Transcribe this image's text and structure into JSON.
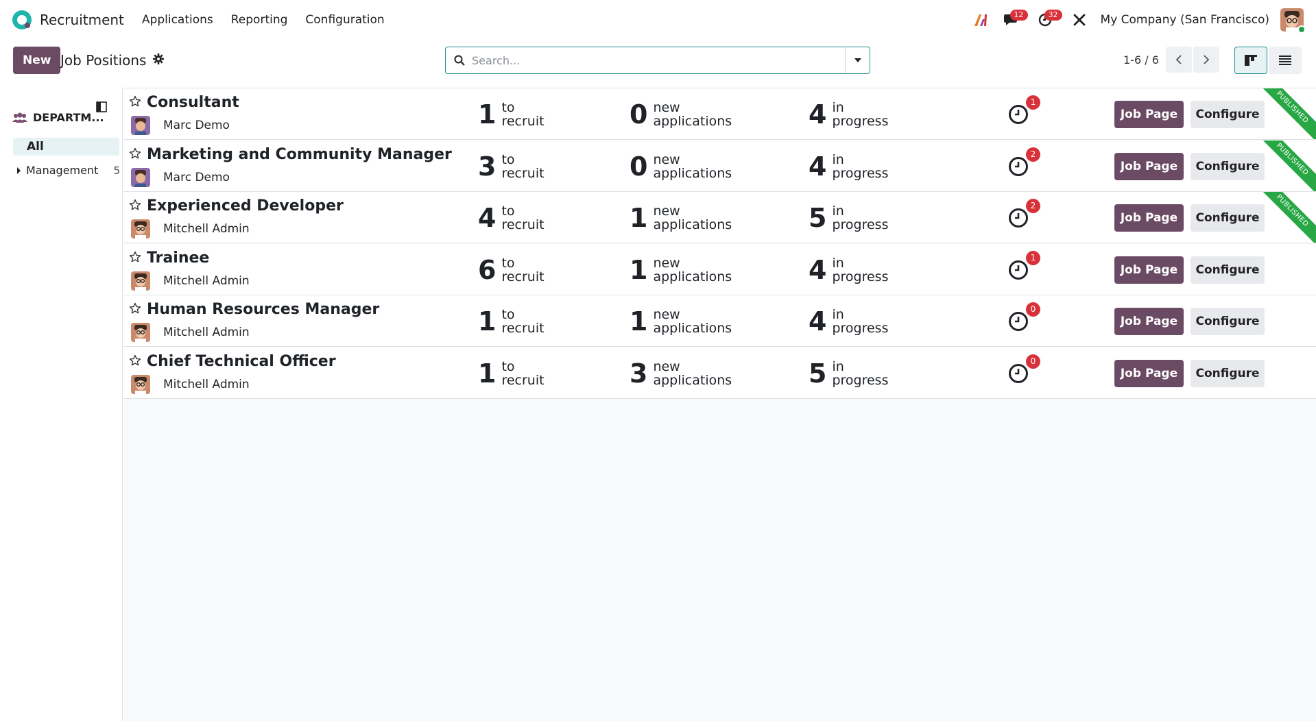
{
  "topbar": {
    "app_name": "Recruitment",
    "menu": [
      "Applications",
      "Reporting",
      "Configuration"
    ],
    "messages_badge": "12",
    "activities_badge": "32",
    "company": "My Company (San Francisco)"
  },
  "control": {
    "new_label": "New",
    "title": "Job Positions",
    "search_placeholder": "Search...",
    "pager": "1-6 / 6"
  },
  "sidebar": {
    "heading": "DEPARTM...",
    "all_label": "All",
    "items": [
      {
        "label": "Management",
        "count": "5"
      }
    ]
  },
  "jobs": [
    {
      "title": "Consultant",
      "manager": "Marc Demo",
      "to_recruit": "1",
      "new_apps": "0",
      "in_progress": "4",
      "activities": "1",
      "published": true
    },
    {
      "title": "Marketing and Community Manager",
      "manager": "Marc Demo",
      "to_recruit": "3",
      "new_apps": "0",
      "in_progress": "4",
      "activities": "2",
      "published": true
    },
    {
      "title": "Experienced Developer",
      "manager": "Mitchell Admin",
      "to_recruit": "4",
      "new_apps": "1",
      "in_progress": "5",
      "activities": "2",
      "published": true
    },
    {
      "title": "Trainee",
      "manager": "Mitchell Admin",
      "to_recruit": "6",
      "new_apps": "1",
      "in_progress": "4",
      "activities": "1",
      "published": false
    },
    {
      "title": "Human Resources Manager",
      "manager": "Mitchell Admin",
      "to_recruit": "1",
      "new_apps": "1",
      "in_progress": "4",
      "activities": "0",
      "published": false
    },
    {
      "title": "Chief Technical Officer",
      "manager": "Mitchell Admin",
      "to_recruit": "1",
      "new_apps": "3",
      "in_progress": "5",
      "activities": "0",
      "published": false
    }
  ],
  "labels": {
    "to_recruit_1": "to",
    "to_recruit_2": "recruit",
    "new_1": "new",
    "new_2": "applications",
    "progress_1": "in",
    "progress_2": "progress",
    "job_page": "Job Page",
    "configure": "Configure",
    "published": "PUBLISHED"
  },
  "colors": {
    "brand": "#6b4a63",
    "accent": "#1fb5ad",
    "badge": "#d9313a",
    "published": "#28a745"
  }
}
